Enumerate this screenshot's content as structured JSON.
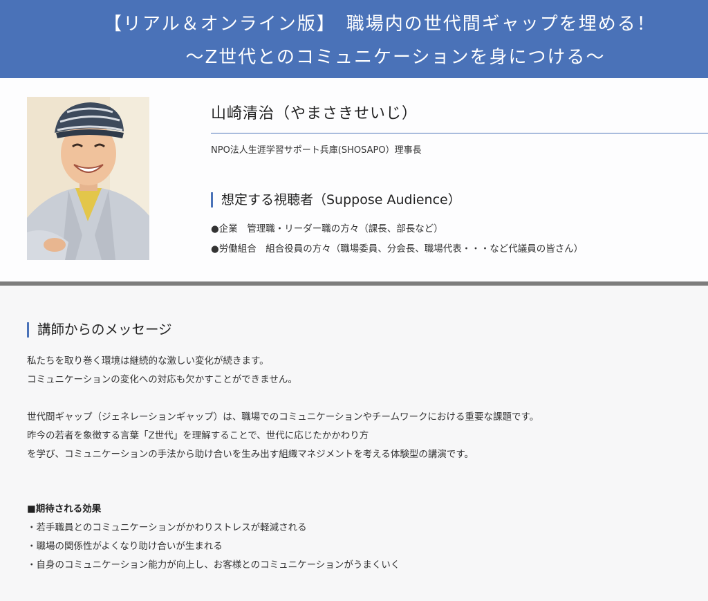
{
  "header": {
    "line1": "【リアル＆オンライン版】　職場内の世代間ギャップを埋める！",
    "line2": "～Z世代とのコミュニケーションを身につける～"
  },
  "speaker": {
    "name": "山崎清治（やまさきせいじ）",
    "org": "NPO法人生涯学習サポート兵庫(SHOSAPO）理事長"
  },
  "audience": {
    "title": "想定する視聴者（Suppose Audience）",
    "items": [
      "●企業　管理職・リーダー職の方々（課長、部長など）",
      "●労働組合　組合役員の方々（職場委員、分会長、職場代表・・・など代議員の皆さん）"
    ]
  },
  "message": {
    "title": "講師からのメッセージ",
    "lines": [
      "私たちを取り巻く環境は継続的な激しい変化が続きます。",
      "コミュニケーションの変化への対応も欠かすことができません。",
      "世代間ギャップ（ジェネレーションギャップ）は、職場でのコミュニケーションやチームワークにおける重要な課題です。",
      "昨今の若者を象徴する言葉「Z世代」を理解することで、世代に応じたかかわり方",
      "を学び、コミュニケーションの手法から助け合いを生み出す組織マネジメントを考える体験型の講演です。"
    ]
  },
  "effects": {
    "heading": "■期待される効果",
    "items": [
      "・若手職員とのコミュニケーションがかわりストレスが軽減される",
      "・職場の関係性がよくなり助け合いが生まれる",
      "・自身のコミュニケーション能力が向上し、お客様とのコミュニケーションがうまくいく"
    ]
  },
  "colors": {
    "accent": "#4a72b8",
    "divider": "#7d7d7d"
  }
}
